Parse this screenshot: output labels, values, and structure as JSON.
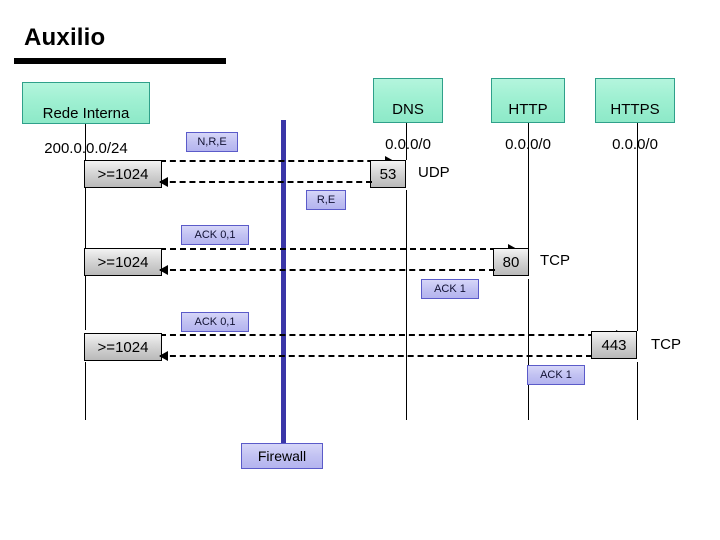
{
  "slide": {
    "title": "Auxilio",
    "background_color": "#ffffff"
  },
  "colors": {
    "node_fill": "#9ff0d2",
    "node_border": "#2fa08a",
    "port_fill": "#d9d9d9",
    "port_border": "#000000",
    "tag_fill": "#c2c2f2",
    "tag_border": "#5b5bc9",
    "firewall_line": "#3a36a8",
    "lifeline": "#000000",
    "text": "#000000"
  },
  "nodes": [
    {
      "id": "internal-network",
      "line1": "Rede Interna",
      "line2": "200.0.0.0/24"
    },
    {
      "id": "dns-server",
      "line1": "DNS",
      "line2": "0.0.0/0"
    },
    {
      "id": "http-server",
      "line1": "HTTP",
      "line2": "0.0.0/0"
    },
    {
      "id": "https-server",
      "line1": "HTTPS",
      "line2": "0.0.0/0"
    }
  ],
  "firewall": {
    "label": "Firewall"
  },
  "flows": [
    {
      "id": "dns-udp",
      "client_port": ">=1024",
      "server_port": "53",
      "protocol": "UDP",
      "request_tag": "N,R,E",
      "response_tag": "R,E"
    },
    {
      "id": "http-tcp",
      "client_port": ">=1024",
      "server_port": "80",
      "protocol": "TCP",
      "request_tag": "ACK 0,1",
      "response_tag": "ACK 1"
    },
    {
      "id": "https-tcp",
      "client_port": ">=1024",
      "server_port": "443",
      "protocol": "TCP",
      "request_tag": "ACK 0,1",
      "response_tag": "ACK 1"
    }
  ]
}
